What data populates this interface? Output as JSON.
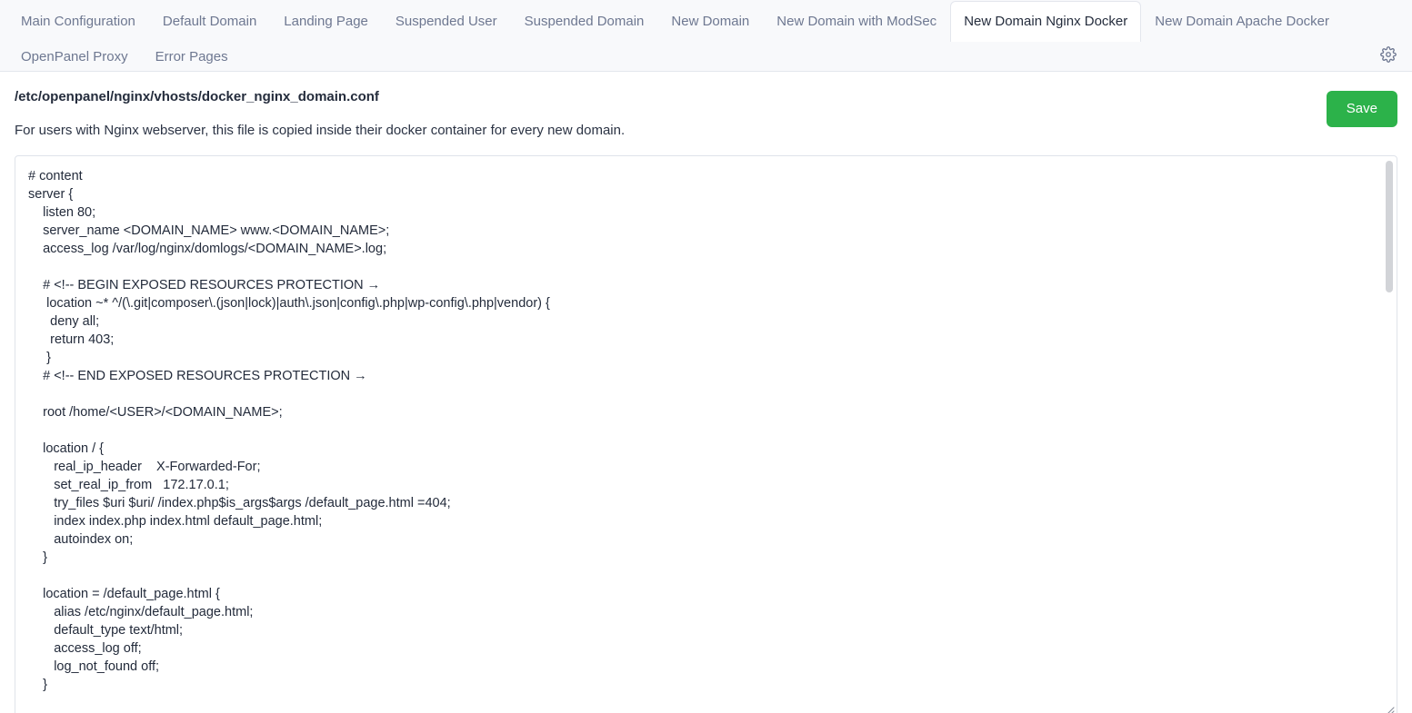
{
  "tabs": {
    "row1": [
      {
        "label": "Main Configuration",
        "active": false
      },
      {
        "label": "Default Domain",
        "active": false
      },
      {
        "label": "Landing Page",
        "active": false
      },
      {
        "label": "Suspended User",
        "active": false
      },
      {
        "label": "Suspended Domain",
        "active": false
      },
      {
        "label": "New Domain",
        "active": false
      },
      {
        "label": "New Domain with ModSec",
        "active": false
      },
      {
        "label": "New Domain Nginx Docker",
        "active": true
      },
      {
        "label": "New Domain Apache Docker",
        "active": false
      }
    ],
    "row2": [
      {
        "label": "OpenPanel Proxy",
        "active": false
      },
      {
        "label": "Error Pages",
        "active": false
      }
    ],
    "settings_icon": "gear-icon"
  },
  "header": {
    "file_path": "/etc/openpanel/nginx/vhosts/docker_nginx_domain.conf",
    "description": "For users with Nginx webserver, this file is copied inside their docker container for every new domain.",
    "save_label": "Save"
  },
  "editor": {
    "content": "# content\nserver {\n    listen 80;\n    server_name <DOMAIN_NAME> www.<DOMAIN_NAME>;\n    access_log /var/log/nginx/domlogs/<DOMAIN_NAME>.log;\n\n    # <!-- BEGIN EXPOSED RESOURCES PROTECTION →\n     location ~* ^/(\\.git|composer\\.(json|lock)|auth\\.json|config\\.php|wp-config\\.php|vendor) {\n      deny all;\n      return 403;\n     }\n    # <!-- END EXPOSED RESOURCES PROTECTION →\n\n    root /home/<USER>/<DOMAIN_NAME>;\n\n    location / {\n       real_ip_header    X-Forwarded-For;\n       set_real_ip_from   172.17.0.1;\n       try_files $uri $uri/ /index.php$is_args$args /default_page.html =404;\n       index index.php index.html default_page.html;\n       autoindex on;\n    }\n\n    location = /default_page.html {\n       alias /etc/nginx/default_page.html;\n       default_type text/html;\n       access_log off;\n       log_not_found off;\n    }\n\n    location ~ \\.php$ {"
  },
  "colors": {
    "accent_save": "#2cb24a",
    "tab_text": "#6e7891",
    "tab_active_text": "#252d3d",
    "tabbar_bg": "#f8f9fb",
    "border": "#e3e6ed",
    "editor_text": "#232b3b"
  }
}
